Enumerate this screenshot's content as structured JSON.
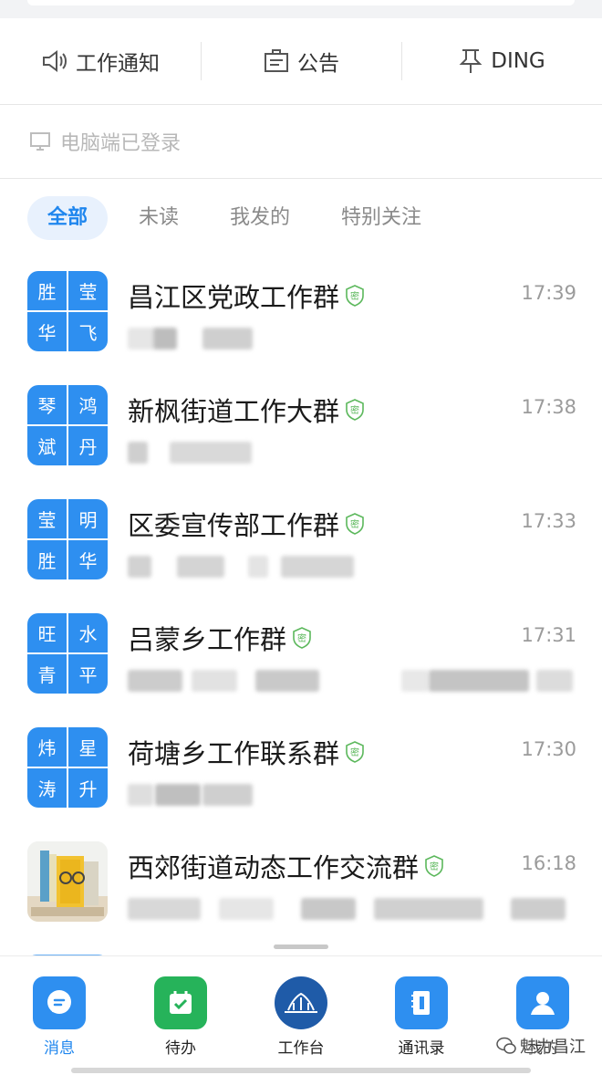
{
  "quick_actions": [
    {
      "label": "工作通知",
      "icon": "speaker-icon"
    },
    {
      "label": "公告",
      "icon": "notice-board-icon"
    },
    {
      "label": "DING",
      "icon": "pin-icon"
    }
  ],
  "pc_status": {
    "text": "电脑端已登录",
    "icon": "monitor-icon"
  },
  "filters": [
    {
      "label": "全部",
      "active": true
    },
    {
      "label": "未读",
      "active": false
    },
    {
      "label": "我发的",
      "active": false
    },
    {
      "label": "特别关注",
      "active": false
    }
  ],
  "chats": [
    {
      "name": "昌江区党政工作群",
      "time": "17:39",
      "avatar_chars": [
        "胜",
        "莹",
        "华",
        "飞"
      ],
      "badge": "密"
    },
    {
      "name": "新枫街道工作大群",
      "time": "17:38",
      "avatar_chars": [
        "琴",
        "鸿",
        "斌",
        "丹"
      ],
      "badge": "密"
    },
    {
      "name": "区委宣传部工作群",
      "time": "17:33",
      "avatar_chars": [
        "莹",
        "明",
        "胜",
        "华"
      ],
      "badge": "密"
    },
    {
      "name": "吕蒙乡工作群",
      "time": "17:31",
      "avatar_chars": [
        "旺",
        "水",
        "青",
        "平"
      ],
      "badge": "密"
    },
    {
      "name": "荷塘乡工作联系群",
      "time": "17:30",
      "avatar_chars": [
        "炜",
        "星",
        "涛",
        "升"
      ],
      "badge": "密"
    },
    {
      "name": "西郊街道动态工作交流群",
      "time": "16:18",
      "avatar_chars": [],
      "badge": "密"
    }
  ],
  "tabbar": [
    {
      "label": "消息",
      "icon": "message-bubble-icon",
      "active": true,
      "color": "#2e8ff0"
    },
    {
      "label": "待办",
      "icon": "calendar-check-icon",
      "active": false,
      "color": "#26b35a"
    },
    {
      "label": "工作台",
      "icon": "workbench-logo-icon",
      "active": false,
      "color": "#1f5ba8"
    },
    {
      "label": "通讯录",
      "icon": "contacts-book-icon",
      "active": false,
      "color": "#2e8ff0"
    },
    {
      "label": "我的",
      "icon": "person-icon",
      "active": false,
      "color": "#2e8ff0"
    }
  ],
  "watermark": {
    "text": "魅力昌江",
    "icon": "wechat-icon"
  },
  "colors": {
    "accent": "#1f86ee",
    "avatar_blue": "#2e8ff0",
    "badge_green": "#5cb85c",
    "todo_green": "#26b35a"
  }
}
